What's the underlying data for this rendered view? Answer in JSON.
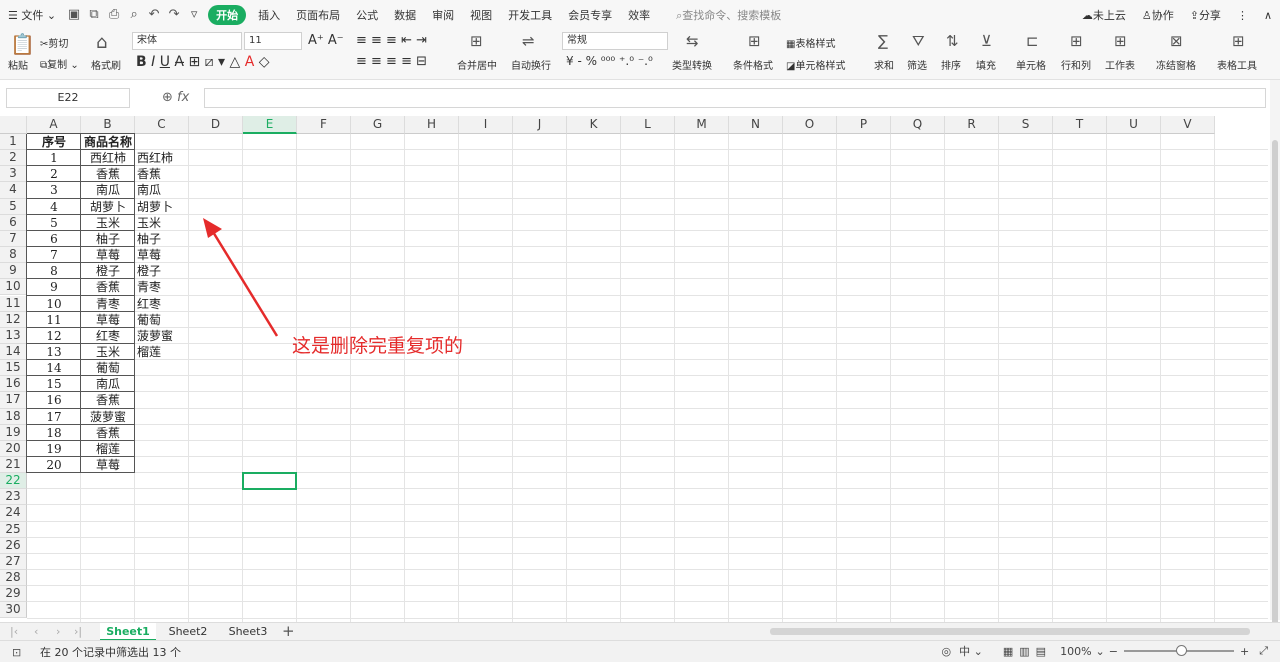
{
  "menubar": {
    "file": "文件",
    "tabs": [
      "开始",
      "插入",
      "页面布局",
      "公式",
      "数据",
      "审阅",
      "视图",
      "开发工具",
      "会员专享",
      "效率"
    ],
    "active_tab": "开始",
    "search": "查找命令、搜索模板",
    "cloud": "未上云",
    "collab": "协作",
    "share": "分享"
  },
  "ribbon": {
    "paste": "粘贴",
    "cut": "剪切",
    "copy": "复制",
    "format_painter": "格式刷",
    "font_name": "宋体",
    "font_size": "11",
    "merge_center": "合并居中",
    "wrap_text": "自动换行",
    "number_format": "常规",
    "type_convert": "类型转换",
    "cond_format": "条件格式",
    "table_style": "表格样式",
    "cell_style": "单元格样式",
    "sum": "求和",
    "filter": "筛选",
    "sort": "排序",
    "fill": "填充",
    "cell": "单元格",
    "rowcol": "行和列",
    "worksheet": "工作表",
    "freeze": "冻结窗格",
    "table_tools": "表格工具"
  },
  "formula_bar": {
    "name_box": "E22",
    "fx": "fx",
    "value": ""
  },
  "columns": [
    "A",
    "B",
    "C",
    "D",
    "E",
    "F",
    "G",
    "H",
    "I",
    "J",
    "K",
    "L",
    "M",
    "N",
    "O",
    "P",
    "Q",
    "R",
    "S",
    "T",
    "U",
    "V"
  ],
  "selected_column": "E",
  "selected_row": 22,
  "rows": [
    1,
    2,
    3,
    4,
    5,
    6,
    7,
    8,
    9,
    10,
    11,
    12,
    13,
    14,
    15,
    16,
    17,
    18,
    19,
    20,
    21,
    22,
    23,
    24,
    25,
    26,
    27,
    28,
    29,
    30
  ],
  "table": {
    "headers": [
      "序号",
      "商品名称"
    ],
    "data": [
      [
        "1",
        "西红柿"
      ],
      [
        "2",
        "香蕉"
      ],
      [
        "3",
        "南瓜"
      ],
      [
        "4",
        "胡萝卜"
      ],
      [
        "5",
        "玉米"
      ],
      [
        "6",
        "柚子"
      ],
      [
        "7",
        "草莓"
      ],
      [
        "8",
        "橙子"
      ],
      [
        "9",
        "香蕉"
      ],
      [
        "10",
        "青枣"
      ],
      [
        "11",
        "草莓"
      ],
      [
        "12",
        "红枣"
      ],
      [
        "13",
        "玉米"
      ],
      [
        "14",
        "葡萄"
      ],
      [
        "15",
        "南瓜"
      ],
      [
        "16",
        "香蕉"
      ],
      [
        "17",
        "菠萝蜜"
      ],
      [
        "18",
        "香蕉"
      ],
      [
        "19",
        "榴莲"
      ],
      [
        "20",
        "草莓"
      ]
    ]
  },
  "unique_list": [
    "西红柿",
    "香蕉",
    "南瓜",
    "胡萝卜",
    "玉米",
    "柚子",
    "草莓",
    "橙子",
    "青枣",
    "红枣",
    "葡萄",
    "菠萝蜜",
    "榴莲"
  ],
  "annotation": "这是删除完重复项的",
  "annotation_color": "#e52b2b",
  "accent_color": "#1aad61",
  "sheets": [
    "Sheet1",
    "Sheet2",
    "Sheet3"
  ],
  "active_sheet": "Sheet1",
  "status": {
    "text": "在 20 个记录中筛选出 13 个",
    "zoom": "100%"
  }
}
